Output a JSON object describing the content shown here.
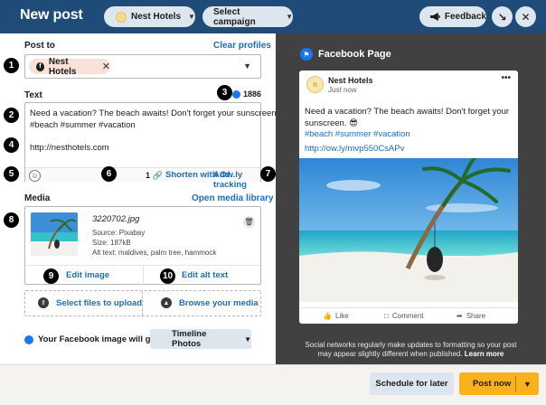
{
  "header": {
    "title": "New post",
    "account_label": "Nest Hotels",
    "campaign_label": "Select campaign",
    "feedback_label": "Feedback"
  },
  "post_to": {
    "label": "Post to",
    "clear_label": "Clear profiles",
    "chip_label": "Nest Hotels"
  },
  "text": {
    "label": "Text",
    "char_count": "1886",
    "lines": [
      "Need a vacation? The beach awaits! Don't forget your sunscreen. 😎",
      "#beach #summer #vacation",
      "",
      "http://nesthotels.com"
    ],
    "link_count": "1",
    "shorten_label": "Shorten with Ow.ly",
    "tracking_label": "Add tracking"
  },
  "media": {
    "label": "Media",
    "library_label": "Open media library",
    "filename": "3220702.jpg",
    "source": "Source: Pixabay",
    "size": "Size: 187kB",
    "alt_text": "Alt text: maldives, palm tree, hammock",
    "edit_image_label": "Edit image",
    "edit_alt_label": "Edit alt text",
    "upload_label": "Select files to upload",
    "browse_label": "Browse your media"
  },
  "facebook_dest": {
    "label": "Your Facebook image will go to:",
    "value": "Timeline Photos"
  },
  "numbers": [
    "1",
    "2",
    "3",
    "4",
    "5",
    "6",
    "7",
    "8",
    "9",
    "10"
  ],
  "preview": {
    "title": "Facebook Page",
    "name": "Nest Hotels",
    "time": "Just now",
    "text_line1": "Need a vacation? The beach awaits! Don't forget your",
    "text_line2": "sunscreen. 😎",
    "hashtags": "#beach #summer #vacation",
    "link": "http://ow.ly/mvp550CsAPv",
    "like_label": "Like",
    "comment_label": "Comment",
    "share_label": "Share",
    "disclaimer_line1": "Social networks regularly make updates to formatting so your post",
    "disclaimer_line2": "may appear slightly different when published.",
    "learn_more": "Learn more"
  },
  "footer": {
    "schedule_label": "Schedule for later",
    "post_now_label": "Post now"
  },
  "colors": {
    "header_bg": "#1f4b78",
    "accent_blue": "#1f6db3",
    "preview_bg": "#414141",
    "post_button": "#f9b21d"
  },
  "icons": {
    "campaign": "chevron-down-icon",
    "feedback": "megaphone-icon",
    "minimize": "minimize-icon",
    "close": "close-icon",
    "preview": "flag-icon"
  }
}
